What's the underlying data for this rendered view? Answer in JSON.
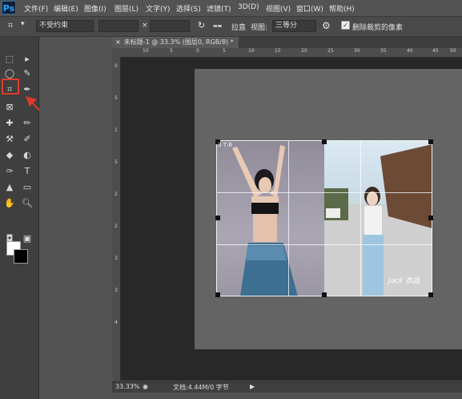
{
  "app": {
    "logo": "Ps"
  },
  "menu": [
    "文件(F)",
    "编辑(E)",
    "图像(I)",
    "图层(L)",
    "文字(Y)",
    "选择(S)",
    "滤镜(T)",
    "3D(D)",
    "视图(V)",
    "窗口(W)",
    "帮助(H)"
  ],
  "options": {
    "ratio_select": "不受约束",
    "swap_symbol": "×",
    "straighten_label": "拉直",
    "view_label": "视图:",
    "view_select": "三等分",
    "delete_cropped_label": "删除裁剪的像素"
  },
  "document": {
    "tab_title": "未标题-1 @ 33.3% (图层0, RGB/8) *",
    "close_glyph": "×",
    "watermark": "Jack 衣品",
    "crop_size": "3 7:6"
  },
  "status": {
    "zoom": "33.33%",
    "file_info": "文档:4.44M/0 字节"
  },
  "rulers": {
    "top": [
      "10",
      "5",
      "0",
      "5",
      "10",
      "15",
      "20",
      "25",
      "30",
      "35",
      "40",
      "45",
      "50"
    ],
    "left": [
      "0",
      "5",
      "1",
      "5",
      "2",
      "2",
      "3",
      "3",
      "4"
    ]
  },
  "colors": {
    "accent": "#2fa3ff",
    "highlight": "#e03a2c",
    "foreground_swatch": "#ffffff",
    "background_swatch": "#000000"
  },
  "tools": [
    "move-tool",
    "marquee-tool",
    "lasso-tool",
    "quick-select-tool",
    "crop-tool",
    "eyedropper-tool",
    "spot-heal-tool",
    "brush-tool",
    "clone-stamp-tool",
    "history-brush-tool",
    "eraser-tool",
    "gradient-tool",
    "blur-tool",
    "dodge-tool",
    "pen-tool",
    "type-tool",
    "path-select-tool",
    "shape-tool",
    "hand-tool",
    "zoom-tool"
  ]
}
